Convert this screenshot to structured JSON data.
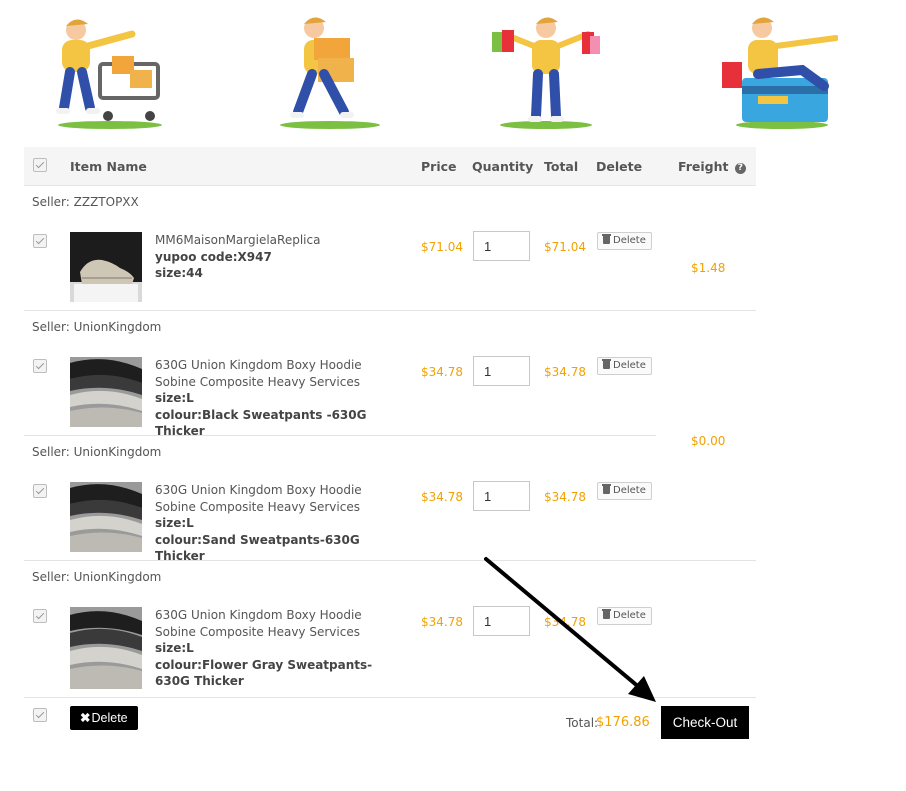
{
  "header": {
    "col_item": "Item Name",
    "col_price": "Price",
    "col_quantity": "Quantity",
    "col_total": "Total",
    "col_delete": "Delete",
    "col_freight": "Freight",
    "help_glyph": "?"
  },
  "groups": [
    {
      "seller": "Seller: ZZZTOPXX",
      "title": "MM6MaisonMargielaReplica",
      "attr1": "yupoo code:X947",
      "attr2": "size:44",
      "price": "$71.04",
      "quantity": "1",
      "total": "$71.04",
      "delete_label": "Delete",
      "freight": "$1.48"
    },
    {
      "seller": "Seller: UnionKingdom",
      "title": "630G Union Kingdom Boxy Hoodie Sobine Composite Heavy Services",
      "attr1": "size:L",
      "attr2": "colour:Black Sweatpants -630G Thicker",
      "price": "$34.78",
      "quantity": "1",
      "total": "$34.78",
      "delete_label": "Delete"
    },
    {
      "seller": "Seller: UnionKingdom",
      "title": "630G Union Kingdom Boxy Hoodie Sobine Composite Heavy Services",
      "attr1": "size:L",
      "attr2": "colour:Sand Sweatpants-630G Thicker",
      "price": "$34.78",
      "quantity": "1",
      "total": "$34.78",
      "delete_label": "Delete",
      "freight": "$0.00"
    },
    {
      "seller": "Seller: UnionKingdom",
      "title": "630G Union Kingdom Boxy Hoodie Sobine Composite Heavy Services",
      "attr1": "size:L",
      "attr2": "colour:Flower Gray Sweatpants-630G Thicker",
      "price": "$34.78",
      "quantity": "1",
      "total": "$34.78",
      "delete_label": "Delete"
    }
  ],
  "footer": {
    "delete_label": "Delete",
    "delete_glyph": "✖",
    "total_label": "Total:",
    "total_value": "$176.86",
    "checkout_label": "Check-Out"
  },
  "colors": {
    "accent_price": "#f2a200",
    "button_dark": "#000000",
    "header_bg": "#f5f5f5"
  },
  "icons": [
    "checkbox-icon",
    "help-icon",
    "trash-icon",
    "close-icon",
    "arrow-annotation"
  ]
}
